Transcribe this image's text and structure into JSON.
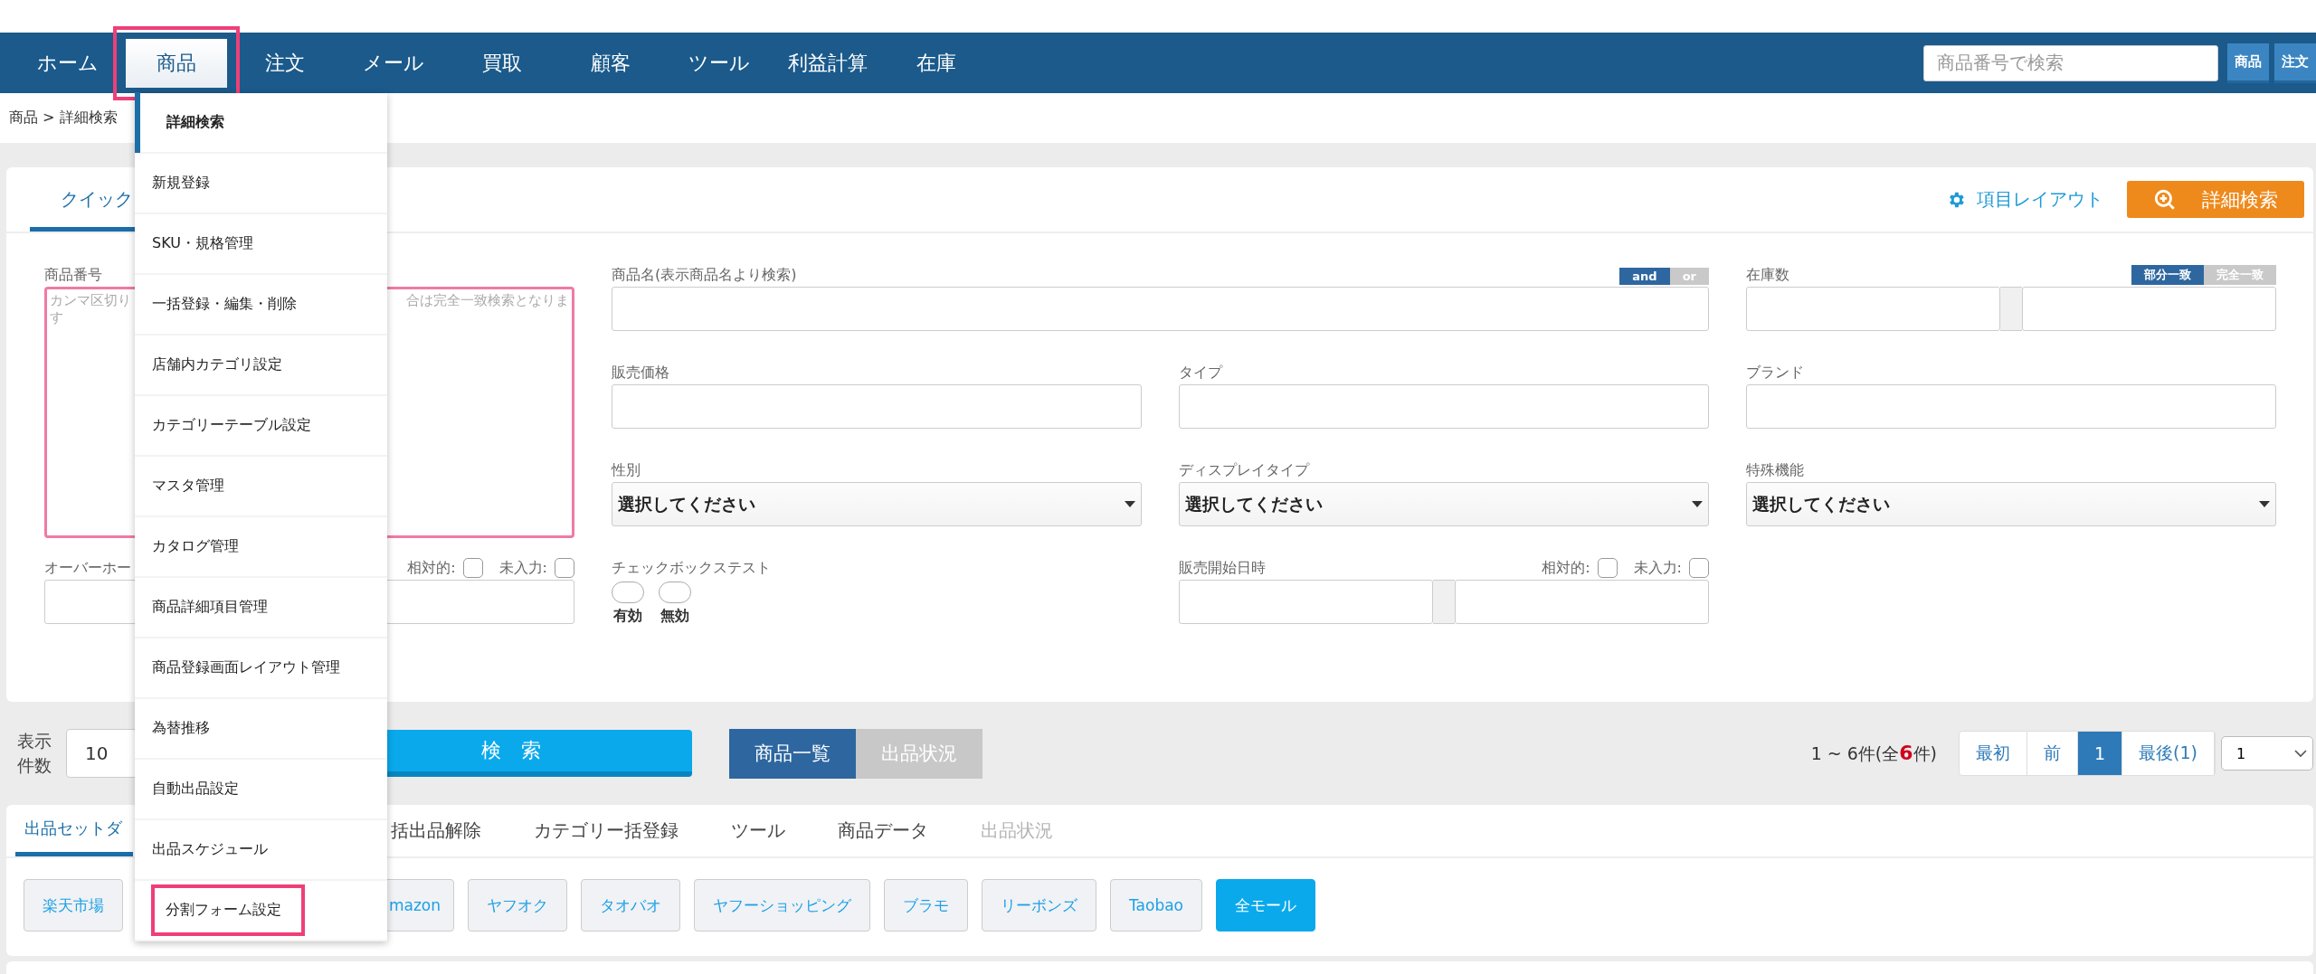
{
  "nav": {
    "items": [
      {
        "label": "ホーム",
        "selected": false,
        "highlighted": false
      },
      {
        "label": "商品",
        "selected": true,
        "highlighted": true
      },
      {
        "label": "注文",
        "selected": false,
        "highlighted": false
      },
      {
        "label": "メール",
        "selected": false,
        "highlighted": false
      },
      {
        "label": "買取",
        "selected": false,
        "highlighted": false
      },
      {
        "label": "顧客",
        "selected": false,
        "highlighted": false
      },
      {
        "label": "ツール",
        "selected": false,
        "highlighted": false
      },
      {
        "label": "利益計算",
        "selected": false,
        "highlighted": false
      },
      {
        "label": "在庫",
        "selected": false,
        "highlighted": false
      }
    ],
    "search": {
      "placeholder": "商品番号で検索"
    },
    "search_buttons": [
      "商品",
      "注文"
    ]
  },
  "breadcrumb": "商品 > 詳細検索",
  "search_panel": {
    "tab": {
      "label": "クイック",
      "selected": true
    },
    "layout_link": "項目レイアウト",
    "detail_button": "詳細検索",
    "fields": [
      {
        "kind": "textarea",
        "label": "商品番号",
        "placeholder_parts": [
          "カンマ区切り",
          "合は完全一致検索となりま",
          "す"
        ]
      },
      {
        "kind": "text",
        "label": "商品名(表示商品名より検索)",
        "match": [
          {
            "label": "and",
            "selected": true
          },
          {
            "label": "or",
            "selected": false
          }
        ]
      },
      {
        "kind": "range",
        "label": "在庫数",
        "match": [
          {
            "label": "部分一致",
            "selected": true
          },
          {
            "label": "完全一致",
            "selected": false
          }
        ]
      },
      {
        "kind": "text",
        "label": "販売価格"
      },
      {
        "kind": "text",
        "label": "タイプ"
      },
      {
        "kind": "text",
        "label": "ブランド"
      },
      {
        "kind": "select",
        "label": "性別",
        "value": "選択してください"
      },
      {
        "kind": "select",
        "label": "ディスプレイタイプ",
        "value": "選択してください"
      },
      {
        "kind": "select",
        "label": "特殊機能",
        "value": "選択してください"
      },
      {
        "kind": "text",
        "label": "オーバーホー",
        "flags": [
          {
            "label": "相対的:",
            "checked": false
          },
          {
            "label": "未入力:",
            "checked": false
          }
        ]
      },
      {
        "kind": "toggles",
        "label": "チェックボックステスト",
        "toggles": [
          {
            "label": "有効",
            "checked": false
          },
          {
            "label": "無効",
            "checked": false
          }
        ]
      },
      {
        "kind": "range",
        "label": "販売開始日時",
        "flags": [
          {
            "label": "相対的:",
            "checked": false
          },
          {
            "label": "未入力:",
            "checked": false
          }
        ]
      }
    ]
  },
  "results_bar": {
    "per_page_label": "表示件数",
    "per_page": "10",
    "search_button": "検　索",
    "views": [
      {
        "label": "商品一覧",
        "selected": true
      },
      {
        "label": "出品状況",
        "selected": false
      }
    ],
    "count": {
      "prefix": "1 ~ 6件(全",
      "total": "6",
      "suffix": "件)"
    },
    "pages": [
      {
        "label": "最初",
        "selected": false
      },
      {
        "label": "前",
        "selected": false
      },
      {
        "label": "1",
        "selected": true
      },
      {
        "label": "最後(1)",
        "selected": false
      }
    ],
    "page_select": "1"
  },
  "action_tabs": [
    {
      "label": "出品セットダ",
      "selected": true,
      "disabled": false
    },
    {
      "label": "括出品解除",
      "selected": false,
      "disabled": false
    },
    {
      "label": "カテゴリー括登録",
      "selected": false,
      "disabled": false
    },
    {
      "label": "ツール",
      "selected": false,
      "disabled": false
    },
    {
      "label": "商品データ",
      "selected": false,
      "disabled": false
    },
    {
      "label": "出品状況",
      "selected": false,
      "disabled": true
    }
  ],
  "malls": [
    {
      "label": "楽天市場",
      "selected": false
    },
    {
      "label": "mazon",
      "selected": false
    },
    {
      "label": "ヤフオク",
      "selected": false
    },
    {
      "label": "タオバオ",
      "selected": false
    },
    {
      "label": "ヤフーショッピング",
      "selected": false
    },
    {
      "label": "ブラモ",
      "selected": false
    },
    {
      "label": "リーボンズ",
      "selected": false
    },
    {
      "label": "Taobao",
      "selected": false
    },
    {
      "label": "全モール",
      "selected": true
    }
  ],
  "dropdown": [
    {
      "label": "詳細検索",
      "selected": true,
      "highlighted": false
    },
    {
      "label": "新規登録",
      "selected": false,
      "highlighted": false
    },
    {
      "label": "SKU・規格管理",
      "selected": false,
      "highlighted": false
    },
    {
      "label": "一括登録・編集・削除",
      "selected": false,
      "highlighted": false
    },
    {
      "label": "店舗内カテゴリ設定",
      "selected": false,
      "highlighted": false
    },
    {
      "label": "カテゴリーテーブル設定",
      "selected": false,
      "highlighted": false
    },
    {
      "label": "マスタ管理",
      "selected": false,
      "highlighted": false
    },
    {
      "label": "カタログ管理",
      "selected": false,
      "highlighted": false
    },
    {
      "label": "商品詳細項目管理",
      "selected": false,
      "highlighted": false
    },
    {
      "label": "商品登録画面レイアウト管理",
      "selected": false,
      "highlighted": false
    },
    {
      "label": "為替推移",
      "selected": false,
      "highlighted": false
    },
    {
      "label": "自動出品設定",
      "selected": false,
      "highlighted": false
    },
    {
      "label": "出品スケジュール",
      "selected": false,
      "highlighted": false
    },
    {
      "label": "分割フォーム設定",
      "selected": false,
      "highlighted": true
    }
  ]
}
